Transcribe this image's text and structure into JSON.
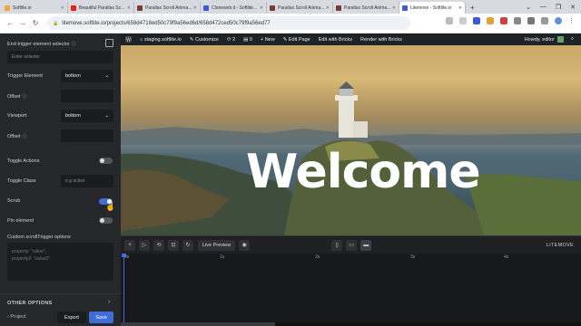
{
  "browser": {
    "tabs": [
      {
        "title": "Softlite.io",
        "color": "#f3a43a",
        "active": false
      },
      {
        "title": "Beautiful Parallax Sc...",
        "color": "#e62117",
        "active": false
      },
      {
        "title": "Parallax Scroll Anima...",
        "color": "#7a3b2e",
        "active": false
      },
      {
        "title": "Cloneweb.it - Softlite...",
        "color": "#3a5bd9",
        "active": false
      },
      {
        "title": "Parallax Scroll Anima...",
        "color": "#7a3b2e",
        "active": false
      },
      {
        "title": "Parallax Scroll Anima...",
        "color": "#7a3b2e",
        "active": false
      },
      {
        "title": "Litemove - Softlite.io",
        "color": "#3a5bd9",
        "active": true
      }
    ],
    "url": "litemove.softlite.io/projects/658d4718ed50c79f9a56ed6d/658d472ced50c79f9a56ed77"
  },
  "wp_admin_bar": {
    "site": "staging.softlite.io",
    "customize": "Customize",
    "updates": "2",
    "comments": "0",
    "new": "New",
    "edit_page": "Edit Page",
    "edit_bricks": "Edit with Bricks",
    "render_bricks": "Render with Bricks",
    "howdy": "Howdy, editor"
  },
  "panel": {
    "end_trigger_label": "End trigger element selector",
    "end_trigger_placeholder": "Enter selector",
    "trigger_element_label": "Trigger Element",
    "trigger_element_value": "bottom",
    "offset1_label": "Offset",
    "viewport_label": "Viewport",
    "viewport_value": "bottom",
    "offset2_label": "Offset",
    "toggle_actions_label": "Toggle Actions",
    "toggle_actions_on": false,
    "toggle_class_label": "Toggle Class",
    "toggle_class_placeholder": "e.g active",
    "scrub_label": "Scrub",
    "scrub_on": true,
    "pin_label": "Pin element",
    "pin_on": false,
    "custom_options_label": "Custom scrollTrigger options",
    "custom_options_placeholder": "property: \"value\",\nproperty2: \"value2\"",
    "other_options": "OTHER OPTIONS",
    "back_project": "Project",
    "export": "Export",
    "save": "Save"
  },
  "preview": {
    "headline": "Welcome"
  },
  "timeline": {
    "live_preview": "Live Preview",
    "brand": "LITEMOVE",
    "ticks": [
      "0s",
      "1s",
      "2s",
      "3s",
      "4s"
    ]
  }
}
